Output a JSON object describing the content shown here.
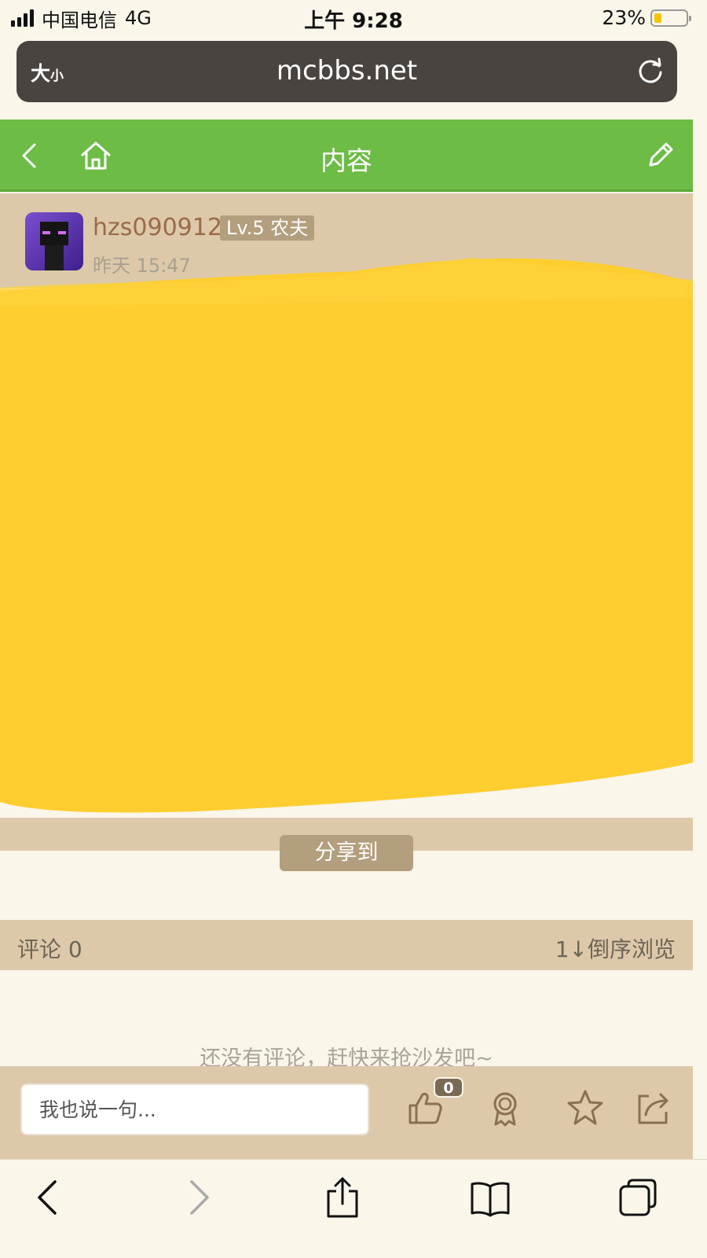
{
  "status_bar": {
    "carrier": "中国电信",
    "network": "4G",
    "time": "上午 9:28",
    "battery_percent": "23%",
    "battery_level": 0.23
  },
  "browser": {
    "text_size_label_big": "大",
    "text_size_label_small": "小",
    "url": "mcbbs.net"
  },
  "nav": {
    "title": "内容"
  },
  "post": {
    "username": "hzs090912",
    "level_badge": "Lv.5 农夫",
    "time": "昨天 15:47"
  },
  "share": {
    "label": "分享到"
  },
  "comments": {
    "count_label": "评论 0",
    "sort_label": "1↓倒序浏览",
    "empty_text": "还没有评论，赶快来抢沙发吧~"
  },
  "comment_bar": {
    "placeholder": "我也说一句...",
    "like_count": "0"
  },
  "colors": {
    "nav_green": "#6cbc45",
    "beige": "#ddc9a9",
    "badge": "#b39e7d",
    "redaction_yellow": "#fecd2f"
  }
}
